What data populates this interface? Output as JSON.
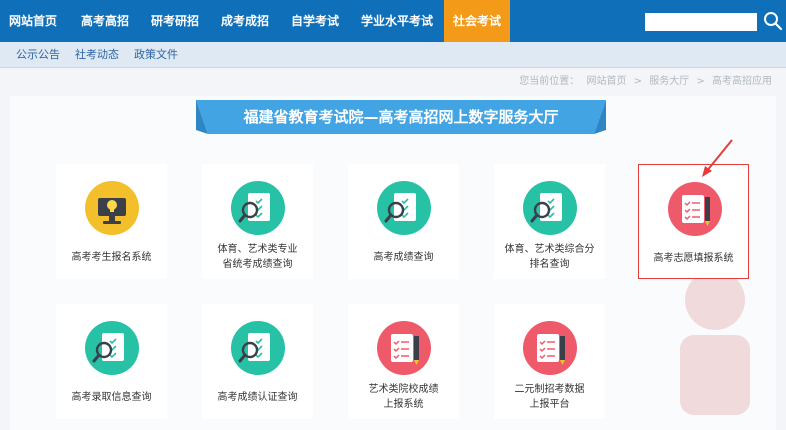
{
  "topnav": {
    "items": [
      "网站首页",
      "高考高招",
      "研考研招",
      "成考成招",
      "自学考试",
      "学业水平考试",
      "社会考试"
    ],
    "active": "社会考试",
    "active_color": "#f39a18",
    "bar_color": "#0f6fb8",
    "search_placeholder": ""
  },
  "subnav": {
    "items": [
      "公示公告",
      "社考动态",
      "政策文件"
    ]
  },
  "breadcrumb": {
    "items": [
      "您当前位置：",
      "网站首页",
      ">",
      "服务大厅",
      ">",
      "高考高招应用"
    ]
  },
  "banner": {
    "title": "福建省教育考试院—高考高招网上数字服务大厅",
    "color": "#43a4e3"
  },
  "cards": [
    {
      "label": "高考考生报名系统",
      "icon": "monitor-lightbulb-icon",
      "color": "#f3c02b"
    },
    {
      "label": "体育、艺术类专业\n省统考成绩查询",
      "icon": "document-search-icon",
      "color": "#27c2a6"
    },
    {
      "label": "高考成绩查询",
      "icon": "document-search-icon",
      "color": "#27c2a6"
    },
    {
      "label": "体育、艺术类综合分\n排名查询",
      "icon": "document-search-icon",
      "color": "#27c2a6"
    },
    {
      "label": "高考志愿填报系统",
      "icon": "checklist-pencil-icon",
      "color": "#ef5a6b"
    },
    {
      "label": "高考录取信息查询",
      "icon": "document-search-icon",
      "color": "#27c2a6"
    },
    {
      "label": "高考成绩认证查询",
      "icon": "document-search-icon",
      "color": "#27c2a6"
    },
    {
      "label": "艺术类院校成绩\n上报系统",
      "icon": "checklist-pencil-icon",
      "color": "#ef5a6b"
    },
    {
      "label": "二元制招考数据\n上报平台",
      "icon": "checklist-pencil-icon",
      "color": "#ef5a6b"
    }
  ],
  "highlight_color": "#e43b3b"
}
